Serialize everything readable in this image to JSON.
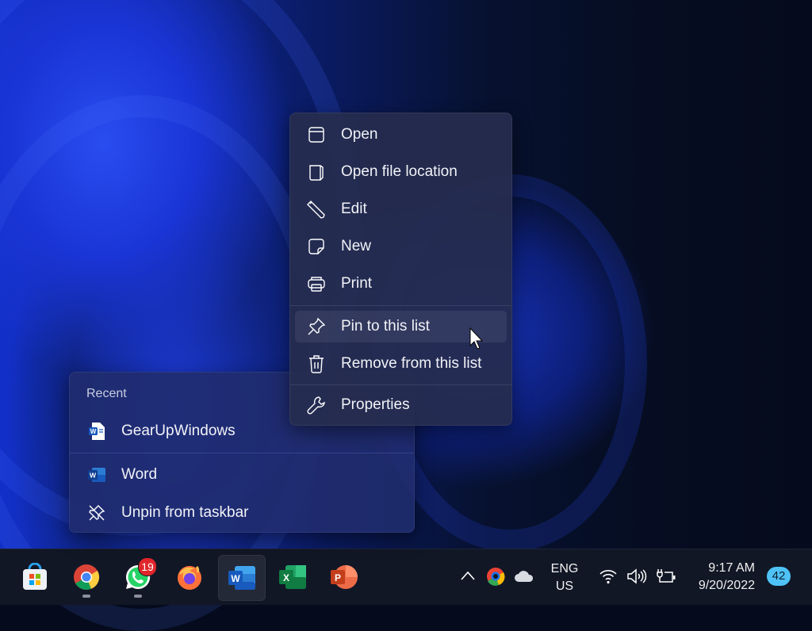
{
  "context_menu": {
    "items": [
      {
        "label": "Open",
        "icon": "window-icon"
      },
      {
        "label": "Open file location",
        "icon": "folder-page-icon"
      },
      {
        "label": "Edit",
        "icon": "pencil-icon"
      },
      {
        "label": "New",
        "icon": "sticky-note-icon"
      },
      {
        "label": "Print",
        "icon": "printer-icon"
      },
      {
        "label": "Pin to this list",
        "icon": "pin-icon",
        "hovered": true
      },
      {
        "label": "Remove from this list",
        "icon": "trash-icon"
      },
      {
        "label": "Properties",
        "icon": "wrench-icon"
      }
    ]
  },
  "jump_list": {
    "header": "Recent",
    "recent": [
      {
        "label": "GearUpWindows",
        "icon": "word-document-icon"
      }
    ],
    "actions": [
      {
        "label": "Word",
        "icon": "word-app-icon"
      },
      {
        "label": "Unpin from taskbar",
        "icon": "unpin-icon"
      }
    ]
  },
  "taskbar": {
    "apps": [
      {
        "name": "Microsoft Store",
        "icon": "store-icon"
      },
      {
        "name": "Google Chrome",
        "icon": "chrome-icon",
        "running": true
      },
      {
        "name": "WhatsApp",
        "icon": "whatsapp-icon",
        "running": true,
        "badge": "19"
      },
      {
        "name": "Firefox",
        "icon": "firefox-icon"
      },
      {
        "name": "Word",
        "icon": "word-icon",
        "active": true
      },
      {
        "name": "Excel",
        "icon": "excel-icon"
      },
      {
        "name": "PowerPoint",
        "icon": "powerpoint-icon"
      }
    ],
    "tray": {
      "language_line1": "ENG",
      "language_line2": "US",
      "time": "9:17 AM",
      "date": "9/20/2022",
      "notification_count": "42"
    }
  },
  "colors": {
    "menu_bg": "#262d4e",
    "taskbar_bg": "#121726",
    "badge_red": "#e0262b",
    "notification_blue": "#4fc3f7"
  }
}
